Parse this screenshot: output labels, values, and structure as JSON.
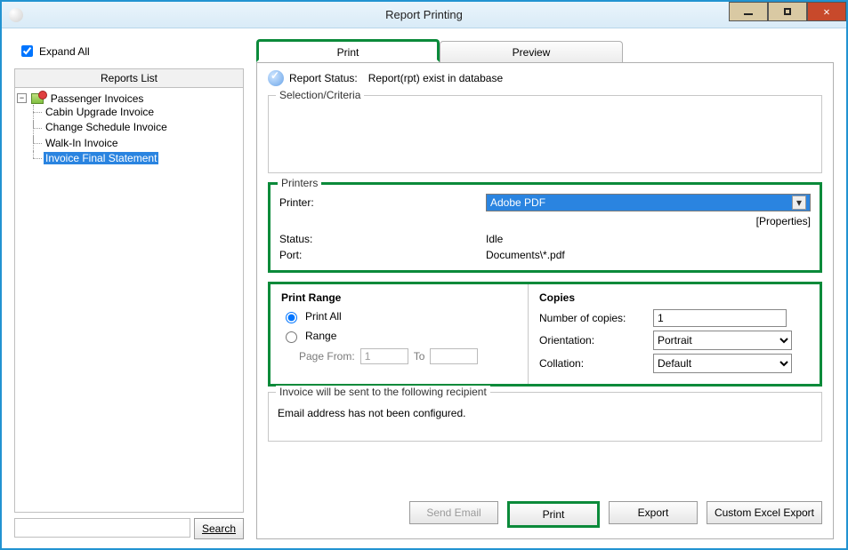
{
  "window": {
    "title": "Report Printing"
  },
  "left": {
    "expand_all_label": "Expand All",
    "expand_all_checked": true,
    "reports_list_header": "Reports List",
    "tree": {
      "root_label": "Passenger Invoices",
      "children": [
        {
          "label": "Cabin Upgrade Invoice",
          "selected": false
        },
        {
          "label": "Change Schedule Invoice",
          "selected": false
        },
        {
          "label": "Walk-In Invoice",
          "selected": false
        },
        {
          "label": "Invoice Final Statement",
          "selected": true
        }
      ]
    },
    "search_placeholder": "",
    "search_button": "Search"
  },
  "tabs": {
    "print": "Print",
    "preview": "Preview",
    "active": "print"
  },
  "status": {
    "label": "Report Status:",
    "value": "Report(rpt) exist in database"
  },
  "selection": {
    "legend": "Selection/Criteria"
  },
  "printers": {
    "legend": "Printers",
    "printer_label": "Printer:",
    "printer_value": "Adobe PDF",
    "properties_link": "[Properties]",
    "status_label": "Status:",
    "status_value": "Idle",
    "port_label": "Port:",
    "port_value": "Documents\\*.pdf"
  },
  "range": {
    "title": "Print Range",
    "print_all": "Print All",
    "range_label": "Range",
    "page_from_label": "Page From:",
    "page_from_value": "1",
    "to_label": "To",
    "to_value": ""
  },
  "copies": {
    "title": "Copies",
    "number_label": "Number of copies:",
    "number_value": "1",
    "orientation_label": "Orientation:",
    "orientation_value": "Portrait",
    "collation_label": "Collation:",
    "collation_value": "Default"
  },
  "recipient": {
    "legend": "Invoice will be sent to the following recipient",
    "message": "Email address has not been configured."
  },
  "buttons": {
    "send_email": "Send Email",
    "print": "Print",
    "export": "Export",
    "custom_excel": "Custom Excel Export"
  }
}
